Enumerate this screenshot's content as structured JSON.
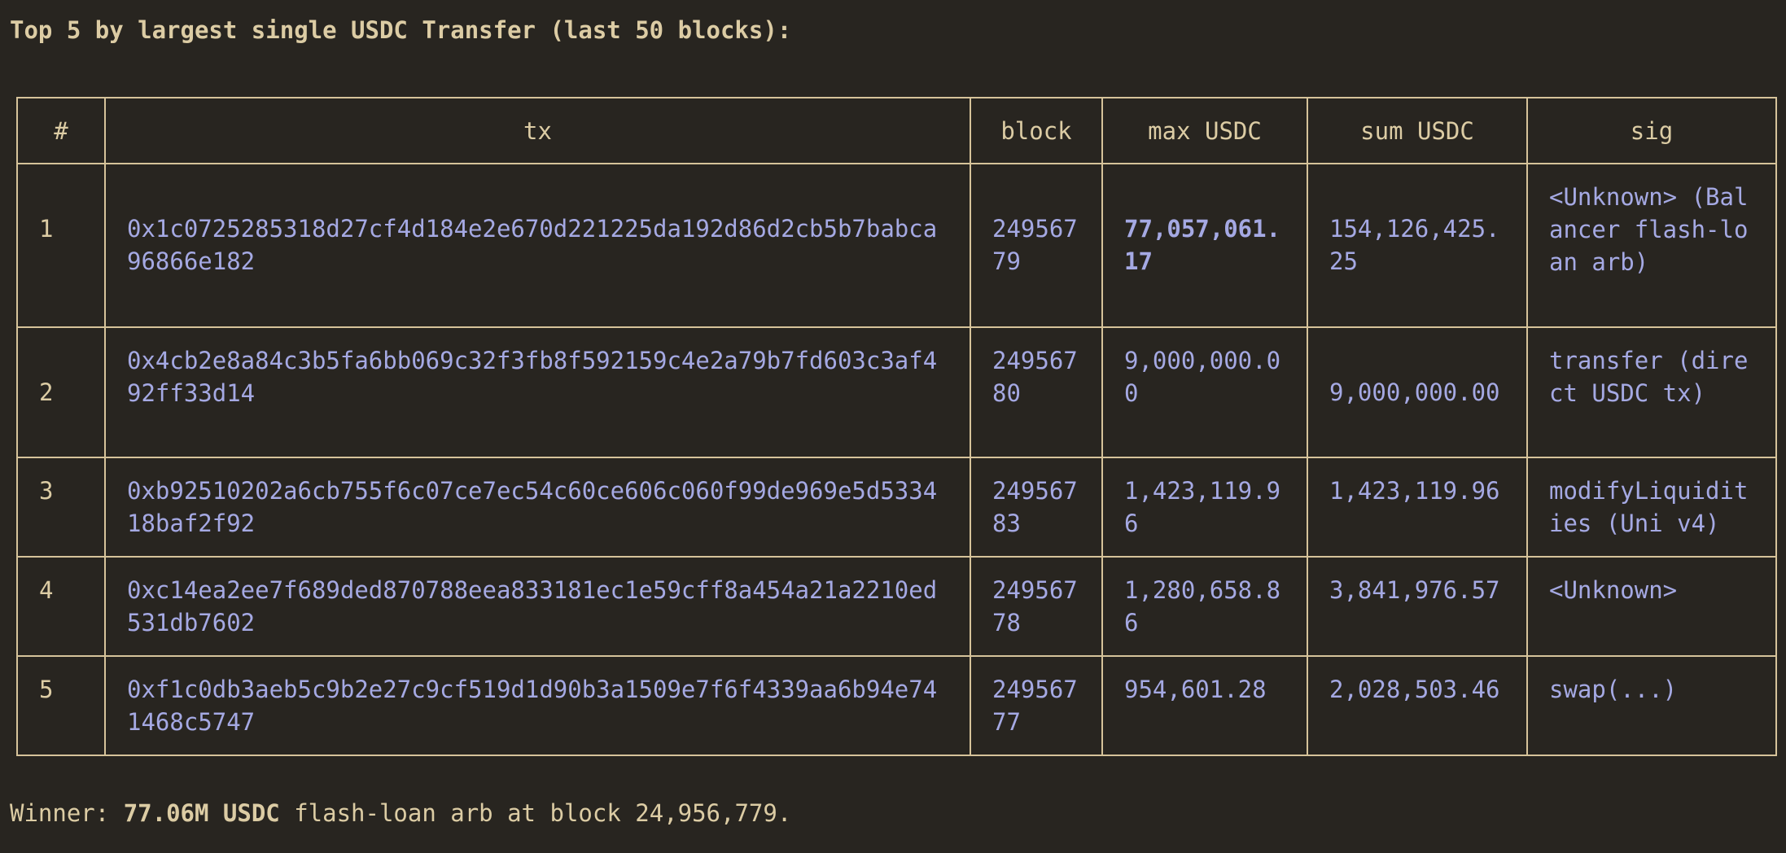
{
  "heading": "Top 5 by largest single USDC Transfer (last 50 blocks):",
  "table": {
    "columns": [
      "#",
      "tx",
      "block",
      "max USDC",
      "sum USDC",
      "sig"
    ],
    "rows": [
      {
        "rank": "1",
        "tx": "0x1c0725285318d27cf4d184e2e670d221225da192d86d2cb5b7babca96866e182",
        "block": "24956779",
        "max_usdc": "77,057,061.17",
        "sum_usdc": "154,126,425.25",
        "sig": "<Unknown> (Balancer flash-loan arb)"
      },
      {
        "rank": "2",
        "tx": "0x4cb2e8a84c3b5fa6bb069c32f3fb8f592159c4e2a79b7fd603c3af492ff33d14",
        "block": "24956780",
        "max_usdc": "9,000,000.00",
        "sum_usdc": "9,000,000.00",
        "sig": "transfer (direct USDC tx)"
      },
      {
        "rank": "3",
        "tx": "0xb92510202a6cb755f6c07ce7ec54c60ce606c060f99de969e5d533418baf2f92",
        "block": "24956783",
        "max_usdc": "1,423,119.96",
        "sum_usdc": "1,423,119.96",
        "sig": "modifyLiquidities (Uni v4)"
      },
      {
        "rank": "4",
        "tx": "0xc14ea2ee7f689ded870788eea833181ec1e59cff8a454a21a2210ed531db7602",
        "block": "24956778",
        "max_usdc": "1,280,658.86",
        "sum_usdc": "3,841,976.57",
        "sig": "<Unknown>"
      },
      {
        "rank": "5",
        "tx": "0xf1c0db3aeb5c9b2e27c9cf519d1d90b3a1509e7f6f4339aa6b94e741468c5747",
        "block": "24956777",
        "max_usdc": "954,601.28",
        "sum_usdc": "2,028,503.46",
        "sig": "swap(...)"
      }
    ]
  },
  "footer": {
    "prefix": "Winner: ",
    "highlight": "77.06M USDC",
    "suffix": " flash-loan arb at block 24,956,779."
  },
  "colors": {
    "background": "#282520",
    "text": "#dccca4",
    "link": "#a5a9e3",
    "border": "#d6c39a"
  }
}
